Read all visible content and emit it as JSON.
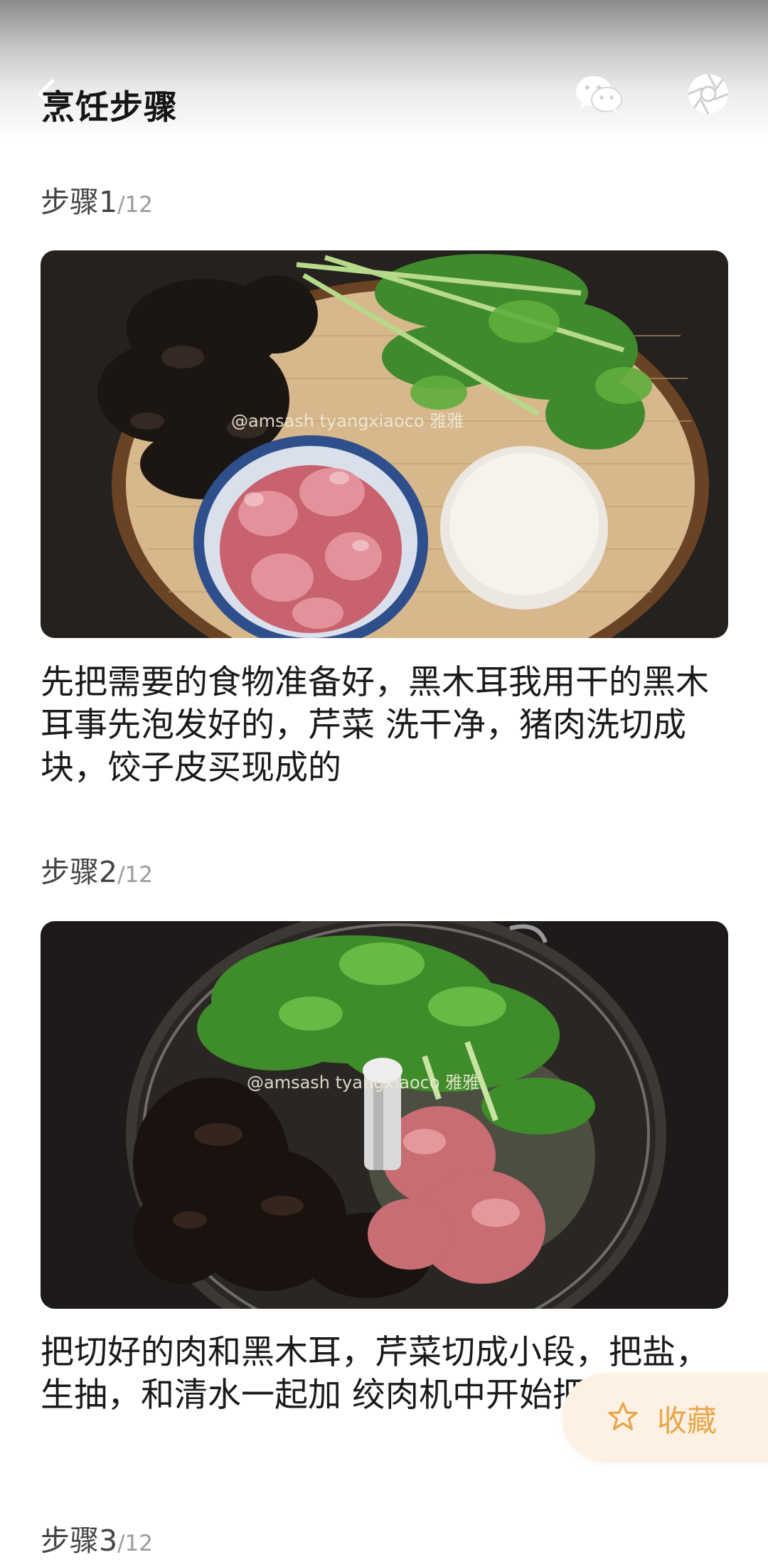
{
  "header": {
    "title": "烹饪步骤",
    "icons": [
      "back-icon",
      "wechat-icon",
      "moments-shutter-icon"
    ]
  },
  "steps": [
    {
      "label": "步骤1",
      "total": "/12",
      "photo_watermark": "@amsash tyangxiaoco 雅雅",
      "text": "先把需要的食物准备好，黑木耳我用干的黑木耳事先泡发好的，芹菜 洗干净，猪肉洗切成块，饺子皮买现成的"
    },
    {
      "label": "步骤2",
      "total": "/12",
      "photo_watermark": "@amsash tyangxiaoco 雅雅",
      "text": "把切好的肉和黑木耳，芹菜切成小段，把盐，生抽，和清水一起加 绞肉机中开始把食物打碎"
    },
    {
      "label": "步骤3",
      "total": "/12"
    }
  ],
  "favorite": {
    "label": "收藏",
    "icon": "star-outline-icon",
    "color": "#e8a64a",
    "background": "#fdf1e3"
  }
}
